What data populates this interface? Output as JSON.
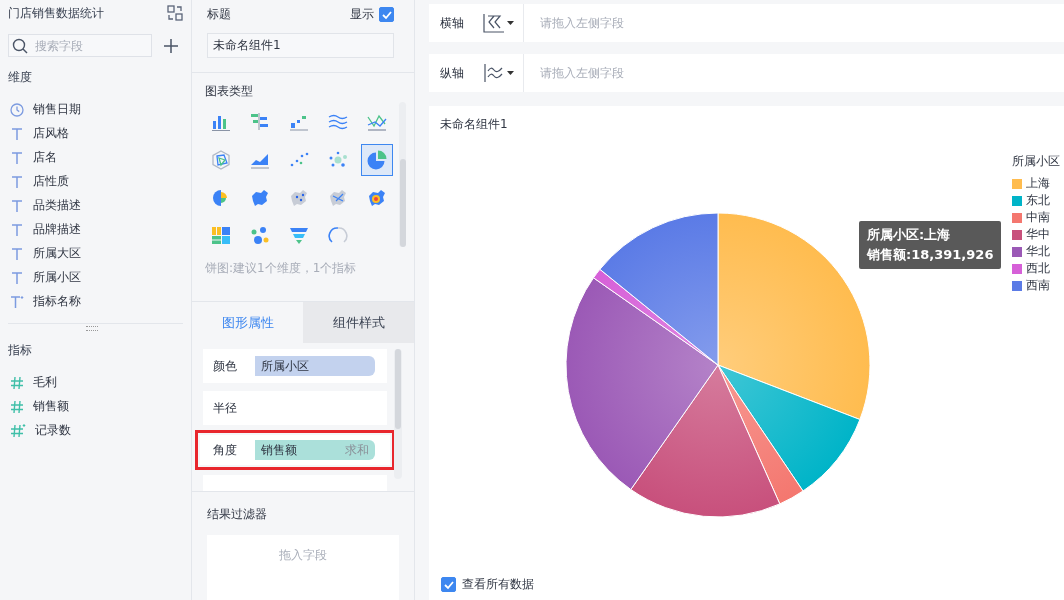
{
  "left_panel": {
    "title": "门店销售数据统计",
    "search": {
      "placeholder": "搜索字段"
    },
    "dimensions": {
      "label": "维度",
      "fields": [
        {
          "kind": "date",
          "name": "销售日期"
        },
        {
          "kind": "text",
          "name": "店风格"
        },
        {
          "kind": "text",
          "name": "店名"
        },
        {
          "kind": "text",
          "name": "店性质"
        },
        {
          "kind": "text",
          "name": "品类描述"
        },
        {
          "kind": "text",
          "name": "品牌描述"
        },
        {
          "kind": "text",
          "name": "所属大区"
        },
        {
          "kind": "text",
          "name": "所属小区"
        },
        {
          "kind": "calc-text",
          "name": "指标名称"
        }
      ]
    },
    "measures": {
      "label": "指标",
      "fields": [
        {
          "kind": "number",
          "name": "毛利"
        },
        {
          "kind": "number",
          "name": "销售额"
        },
        {
          "kind": "calc-number",
          "name": "记录数"
        }
      ]
    }
  },
  "config_panel": {
    "title_label": "标题",
    "show_label": "显示",
    "show_checked": true,
    "title_value": "未命名组件1",
    "chart_type_label": "图表类型",
    "chart_types": [
      {
        "kind": "bar",
        "selected": false
      },
      {
        "kind": "hbar",
        "selected": false
      },
      {
        "kind": "step",
        "selected": false
      },
      {
        "kind": "wave",
        "selected": false
      },
      {
        "kind": "line",
        "selected": false
      },
      {
        "kind": "radar",
        "selected": false
      },
      {
        "kind": "area",
        "selected": false
      },
      {
        "kind": "scatter",
        "selected": false
      },
      {
        "kind": "bubble",
        "selected": false
      },
      {
        "kind": "pie",
        "selected": true
      },
      {
        "kind": "rose",
        "selected": false
      },
      {
        "kind": "map",
        "selected": false
      },
      {
        "kind": "map-dots",
        "selected": false
      },
      {
        "kind": "map-flow",
        "selected": false
      },
      {
        "kind": "heatmap",
        "selected": false
      },
      {
        "kind": "treemap",
        "selected": false
      },
      {
        "kind": "wordcloud",
        "selected": false
      },
      {
        "kind": "funnel",
        "selected": false
      },
      {
        "kind": "gauge",
        "selected": false
      }
    ],
    "hint": "饼图:建议1个维度，1个指标",
    "tabs": [
      {
        "label": "图形属性",
        "selected": true
      },
      {
        "label": "组件样式",
        "selected": false
      }
    ],
    "properties": [
      {
        "label": "颜色",
        "kind": "dimension",
        "field": "所属小区",
        "highlighted": false
      },
      {
        "label": "半径",
        "kind": "empty",
        "highlighted": false
      },
      {
        "label": "角度",
        "kind": "measure",
        "field": "销售额",
        "aggregation": "求和",
        "highlighted": true
      }
    ],
    "filter": {
      "label": "结果过滤器",
      "placeholder": "拖入字段"
    }
  },
  "axes": [
    {
      "kind": "x",
      "label": "横轴",
      "placeholder": "请拖入左侧字段"
    },
    {
      "kind": "y",
      "label": "纵轴",
      "placeholder": "请拖入左侧字段"
    }
  ],
  "chart": {
    "title": "未命名组件1",
    "legend_title": "所属小区",
    "legend": [
      {
        "name": "上海",
        "color": "#ffbc4f"
      },
      {
        "name": "东北",
        "color": "#00b4c8"
      },
      {
        "name": "中南",
        "color": "#f4776f"
      },
      {
        "name": "华中",
        "color": "#c8507c"
      },
      {
        "name": "华北",
        "color": "#9b59b6"
      },
      {
        "name": "西北",
        "color": "#d660d8"
      },
      {
        "name": "西南",
        "color": "#5b7be6"
      }
    ],
    "tooltip": [
      "所属小区:上海",
      "销售额:18,391,926"
    ],
    "show_all": {
      "label": "查看所有数据",
      "checked": true
    }
  }
}
